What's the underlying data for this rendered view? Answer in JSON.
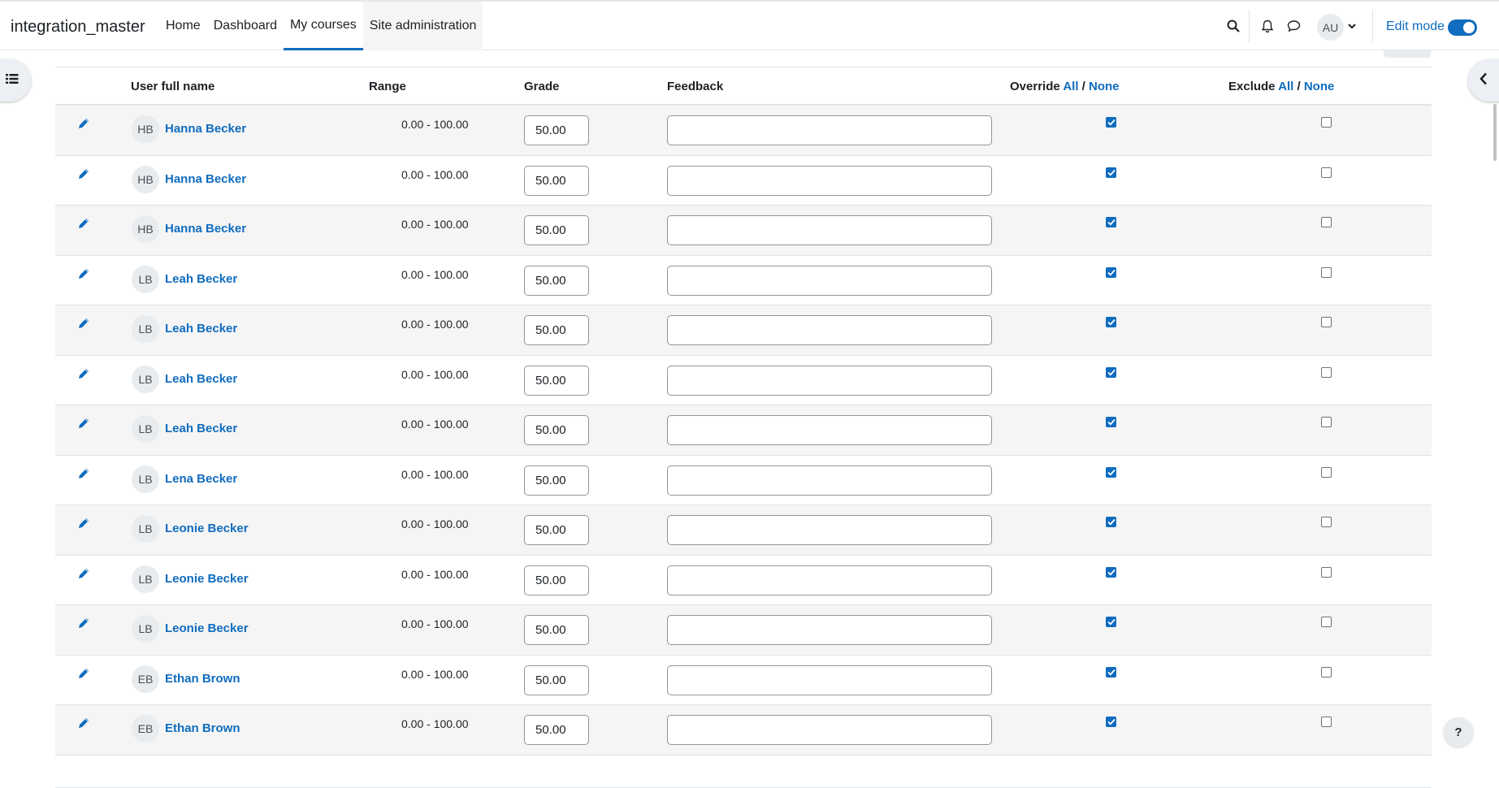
{
  "navbar": {
    "brand": "integration_master",
    "items": [
      {
        "label": "Home"
      },
      {
        "label": "Dashboard"
      },
      {
        "label": "My courses"
      },
      {
        "label": "Site administration"
      }
    ],
    "user_initials": "AU",
    "edit_mode_label": "Edit mode"
  },
  "table": {
    "headers": {
      "name": "User full name",
      "range": "Range",
      "grade": "Grade",
      "feedback": "Feedback",
      "override": "Override",
      "exclude": "Exclude",
      "all": "All",
      "slash": "/",
      "none": "None"
    },
    "rows": [
      {
        "initials": "HB",
        "name": "Hanna Becker",
        "range": "0.00 - 100.00",
        "grade": "50.00",
        "feedback": "",
        "override": true,
        "exclude": false
      },
      {
        "initials": "HB",
        "name": "Hanna Becker",
        "range": "0.00 - 100.00",
        "grade": "50.00",
        "feedback": "",
        "override": true,
        "exclude": false
      },
      {
        "initials": "HB",
        "name": "Hanna Becker",
        "range": "0.00 - 100.00",
        "grade": "50.00",
        "feedback": "",
        "override": true,
        "exclude": false
      },
      {
        "initials": "LB",
        "name": "Leah Becker",
        "range": "0.00 - 100.00",
        "grade": "50.00",
        "feedback": "",
        "override": true,
        "exclude": false
      },
      {
        "initials": "LB",
        "name": "Leah Becker",
        "range": "0.00 - 100.00",
        "grade": "50.00",
        "feedback": "",
        "override": true,
        "exclude": false
      },
      {
        "initials": "LB",
        "name": "Leah Becker",
        "range": "0.00 - 100.00",
        "grade": "50.00",
        "feedback": "",
        "override": true,
        "exclude": false
      },
      {
        "initials": "LB",
        "name": "Leah Becker",
        "range": "0.00 - 100.00",
        "grade": "50.00",
        "feedback": "",
        "override": true,
        "exclude": false
      },
      {
        "initials": "LB",
        "name": "Lena Becker",
        "range": "0.00 - 100.00",
        "grade": "50.00",
        "feedback": "",
        "override": true,
        "exclude": false
      },
      {
        "initials": "LB",
        "name": "Leonie Becker",
        "range": "0.00 - 100.00",
        "grade": "50.00",
        "feedback": "",
        "override": true,
        "exclude": false
      },
      {
        "initials": "LB",
        "name": "Leonie Becker",
        "range": "0.00 - 100.00",
        "grade": "50.00",
        "feedback": "",
        "override": true,
        "exclude": false
      },
      {
        "initials": "LB",
        "name": "Leonie Becker",
        "range": "0.00 - 100.00",
        "grade": "50.00",
        "feedback": "",
        "override": true,
        "exclude": false
      },
      {
        "initials": "EB",
        "name": "Ethan Brown",
        "range": "0.00 - 100.00",
        "grade": "50.00",
        "feedback": "",
        "override": true,
        "exclude": false
      },
      {
        "initials": "EB",
        "name": "Ethan Brown",
        "range": "0.00 - 100.00",
        "grade": "50.00",
        "feedback": "",
        "override": true,
        "exclude": false
      }
    ]
  },
  "help_label": "?",
  "colors": {
    "accent": "#0f6cbf",
    "row_alt": "#f5f5f5"
  },
  "icons": [
    "search-icon",
    "bell-icon",
    "chat-icon",
    "chevron-down-icon",
    "pencil-icon",
    "list-icon",
    "chevron-left-icon"
  ]
}
